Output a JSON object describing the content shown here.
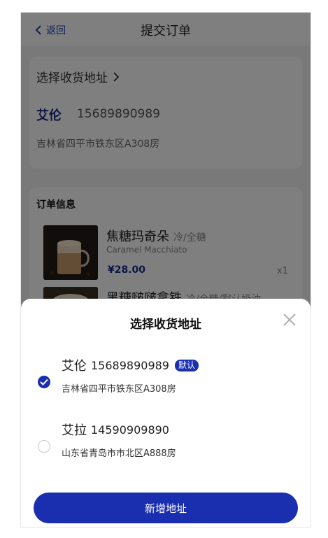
{
  "header": {
    "back_label": "返回",
    "title": "提交订单"
  },
  "address": {
    "select_label": "选择收货地址",
    "name": "艾伦",
    "phone": "15689890989",
    "line": "吉林省四平市铁东区A308房"
  },
  "order": {
    "title": "订单信息",
    "items": [
      {
        "name": "焦糖玛奇朵",
        "options": "冷/全糖",
        "en_name": "Caramel Macchiato",
        "price": "¥28.00",
        "qty": "x1"
      },
      {
        "name": "黑糖啵啵拿铁",
        "options": "冷/全糖/默认奶油"
      }
    ]
  },
  "sheet": {
    "title": "选择收货地址",
    "options": [
      {
        "name": "艾伦",
        "phone": "15689890989",
        "badge": "默认",
        "address": "吉林省四平市铁东区A308房",
        "checked": true
      },
      {
        "name": "艾拉",
        "phone": "14590909890",
        "address": "山东省青岛市市北区A888房",
        "checked": false
      }
    ],
    "add_button": "新增地址"
  },
  "colors": {
    "accent": "#1a2eb0",
    "overlay": "rgba(0,0,0,0.5)"
  }
}
